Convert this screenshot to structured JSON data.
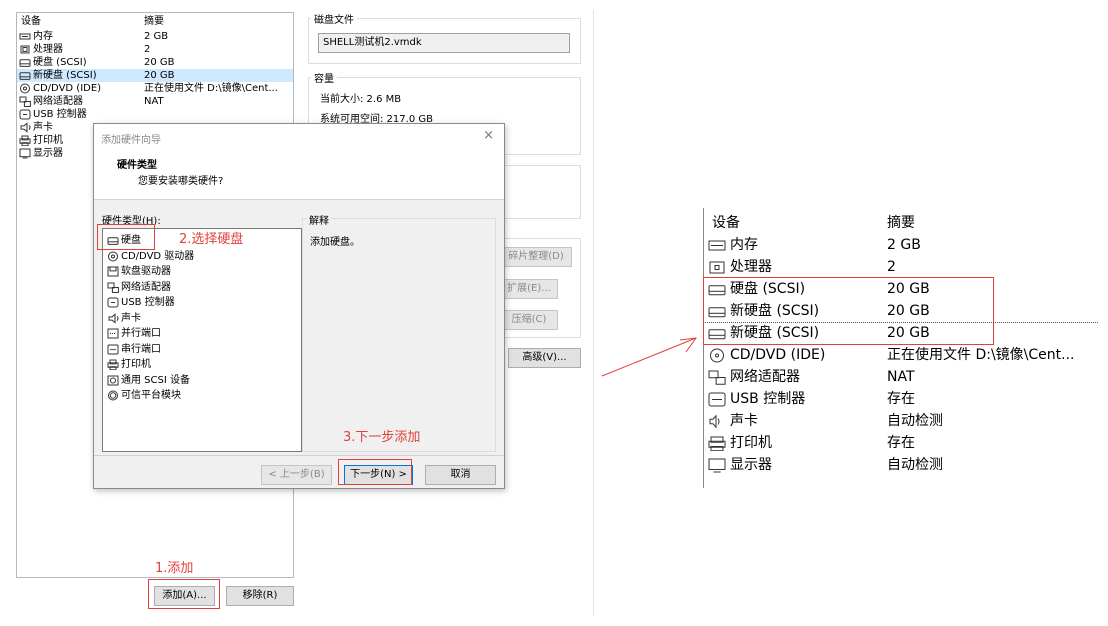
{
  "settings": {
    "columns": {
      "device": "设备",
      "summary": "摘要"
    },
    "devices": [
      {
        "icon": "memory-icon",
        "name": "内存",
        "summary": "2 GB"
      },
      {
        "icon": "cpu-icon",
        "name": "处理器",
        "summary": "2"
      },
      {
        "icon": "harddisk-icon",
        "name": "硬盘 (SCSI)",
        "summary": "20 GB"
      },
      {
        "icon": "harddisk-icon",
        "name": "新硬盘 (SCSI)",
        "summary": "20 GB"
      },
      {
        "icon": "cd-icon",
        "name": "CD/DVD (IDE)",
        "summary": "正在使用文件 D:\\镜像\\Cent..."
      },
      {
        "icon": "network-icon",
        "name": "网络适配器",
        "summary": "NAT"
      },
      {
        "icon": "usb-icon",
        "name": "USB 控制器",
        "summary": ""
      },
      {
        "icon": "sound-icon",
        "name": "声卡",
        "summary": ""
      },
      {
        "icon": "printer-icon",
        "name": "打印机",
        "summary": ""
      },
      {
        "icon": "monitor-icon",
        "name": "显示器",
        "summary": ""
      }
    ],
    "add_button": "添加(A)...",
    "remove_button": "移除(R)",
    "disk_file": {
      "title": "磁盘文件",
      "value": "SHELL测试机2.vmdk"
    },
    "capacity": {
      "title": "容量",
      "current": "当前大小: 2.6 MB",
      "available": "系统可用空间: 217.0 GB"
    },
    "buttons": {
      "defrag": "碎片整理(D)",
      "expand": "扩展(E)...",
      "compact": "压缩(C)",
      "advanced": "高级(V)..."
    }
  },
  "wizard": {
    "title": "添加硬件向导",
    "heading": "硬件类型",
    "subheading": "您要安装哪类硬件?",
    "list_label": "硬件类型(H):",
    "items": [
      {
        "icon": "harddisk-icon",
        "name": "硬盘"
      },
      {
        "icon": "cd-icon",
        "name": "CD/DVD 驱动器"
      },
      {
        "icon": "floppy-icon",
        "name": "软盘驱动器"
      },
      {
        "icon": "network-icon",
        "name": "网络适配器"
      },
      {
        "icon": "usb-icon",
        "name": "USB 控制器"
      },
      {
        "icon": "sound-icon",
        "name": "声卡"
      },
      {
        "icon": "parallel-icon",
        "name": "并行端口"
      },
      {
        "icon": "serial-icon",
        "name": "串行端口"
      },
      {
        "icon": "printer-icon",
        "name": "打印机"
      },
      {
        "icon": "scsi-icon",
        "name": "通用 SCSI 设备"
      },
      {
        "icon": "tpm-icon",
        "name": "可信平台模块"
      }
    ],
    "explain_title": "解释",
    "explain_text": "添加硬盘。",
    "back_button": "< 上一步(B)",
    "next_button": "下一步(N) >",
    "cancel_button": "取消",
    "close_glyph": "×"
  },
  "annotations": {
    "step1": "1.添加",
    "step2": "2.选择硬盘",
    "step3": "3.下一步添加"
  },
  "result": {
    "columns": {
      "device": "设备",
      "summary": "摘要"
    },
    "devices": [
      {
        "icon": "memory-icon",
        "name": "内存",
        "summary": "2 GB"
      },
      {
        "icon": "cpu-icon",
        "name": "处理器",
        "summary": "2"
      },
      {
        "icon": "harddisk-icon",
        "name": "硬盘 (SCSI)",
        "summary": "20 GB"
      },
      {
        "icon": "harddisk-icon",
        "name": "新硬盘 (SCSI)",
        "summary": "20 GB"
      },
      {
        "icon": "harddisk-icon",
        "name": "新硬盘 (SCSI)",
        "summary": "20 GB"
      },
      {
        "icon": "cd-icon",
        "name": "CD/DVD (IDE)",
        "summary": "正在使用文件 D:\\镜像\\Cent..."
      },
      {
        "icon": "network-icon",
        "name": "网络适配器",
        "summary": "NAT"
      },
      {
        "icon": "usb-icon",
        "name": "USB 控制器",
        "summary": "存在"
      },
      {
        "icon": "sound-icon",
        "name": "声卡",
        "summary": "自动检测"
      },
      {
        "icon": "printer-icon",
        "name": "打印机",
        "summary": "存在"
      },
      {
        "icon": "monitor-icon",
        "name": "显示器",
        "summary": "自动检测"
      }
    ]
  },
  "colors": {
    "annotation_red": "#e0413b",
    "selection": "#cde8ff"
  }
}
